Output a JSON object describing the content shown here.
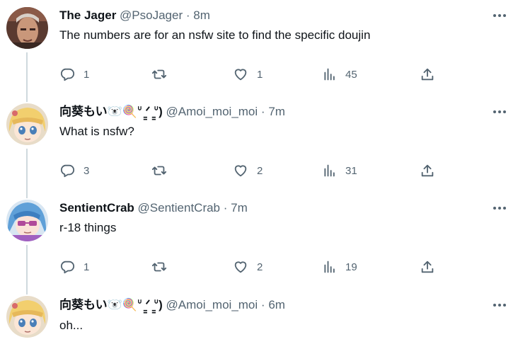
{
  "colors": {
    "text": "#0f1419",
    "muted": "#536471",
    "thread_line": "#cfd9de"
  },
  "tweets": [
    {
      "name": "The Jager",
      "handle": "@PsoJager",
      "sep": "·",
      "time": "8m",
      "text": "The numbers are for an nsfw site to find the specific doujin",
      "avatar_icon": "avatar-illustration",
      "replies": "1",
      "retweets": "",
      "likes": "1",
      "views": "45"
    },
    {
      "name": "向葵もい🐻‍❄️🍭ᐡ ̳ᐟ ̳ᐡ)",
      "handle": "@Amoi_moi_moi",
      "sep": "·",
      "time": "7m",
      "text": "What is nsfw?",
      "avatar_icon": "anime-avatar-yellow",
      "replies": "3",
      "retweets": "",
      "likes": "2",
      "views": "31"
    },
    {
      "name": "SentientCrab",
      "handle": "@SentientCrab",
      "sep": "·",
      "time": "7m",
      "text": "r-18 things",
      "avatar_icon": "anime-avatar-blue",
      "replies": "1",
      "retweets": "",
      "likes": "2",
      "views": "19"
    },
    {
      "name": "向葵もい🐻‍❄️🍭ᐡ ̳ᐟ ̳ᐡ)",
      "handle": "@Amoi_moi_moi",
      "sep": "·",
      "time": "6m",
      "text": "oh...",
      "avatar_icon": "anime-avatar-yellow"
    }
  ]
}
